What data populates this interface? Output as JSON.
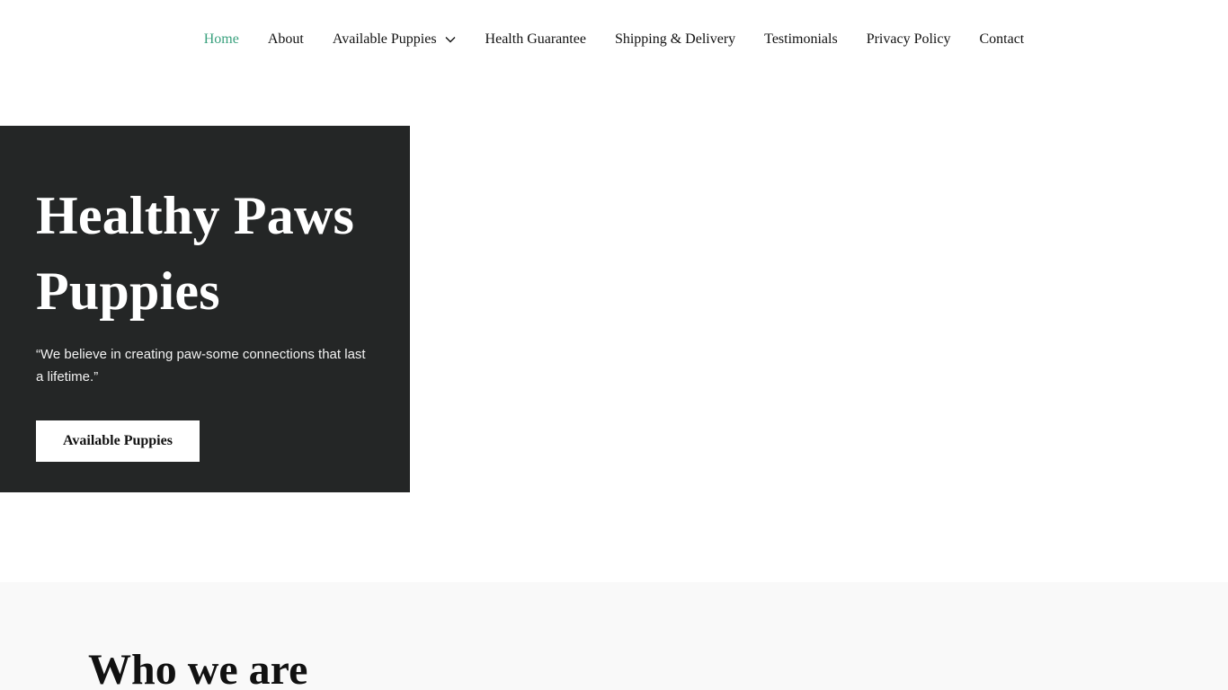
{
  "nav": {
    "items": [
      {
        "label": "Home",
        "active": true
      },
      {
        "label": "About"
      },
      {
        "label": "Available Puppies",
        "has_dropdown": true
      },
      {
        "label": "Health Guarantee"
      },
      {
        "label": "Shipping & Delivery"
      },
      {
        "label": "Testimonials"
      },
      {
        "label": "Privacy Policy"
      },
      {
        "label": "Contact"
      }
    ],
    "active_color": "#3aa17e"
  },
  "hero": {
    "title_line1": "Healthy Paws",
    "title_line2": "Puppies",
    "quote": "“We believe in creating paw-some connections that last a lifetime.”",
    "button_label": "Available Puppies",
    "panel_color": "#242626"
  },
  "who": {
    "title": "Who we are",
    "background": "#f9f9f9"
  },
  "icons": {
    "dropdown": "chevron-down-icon"
  }
}
